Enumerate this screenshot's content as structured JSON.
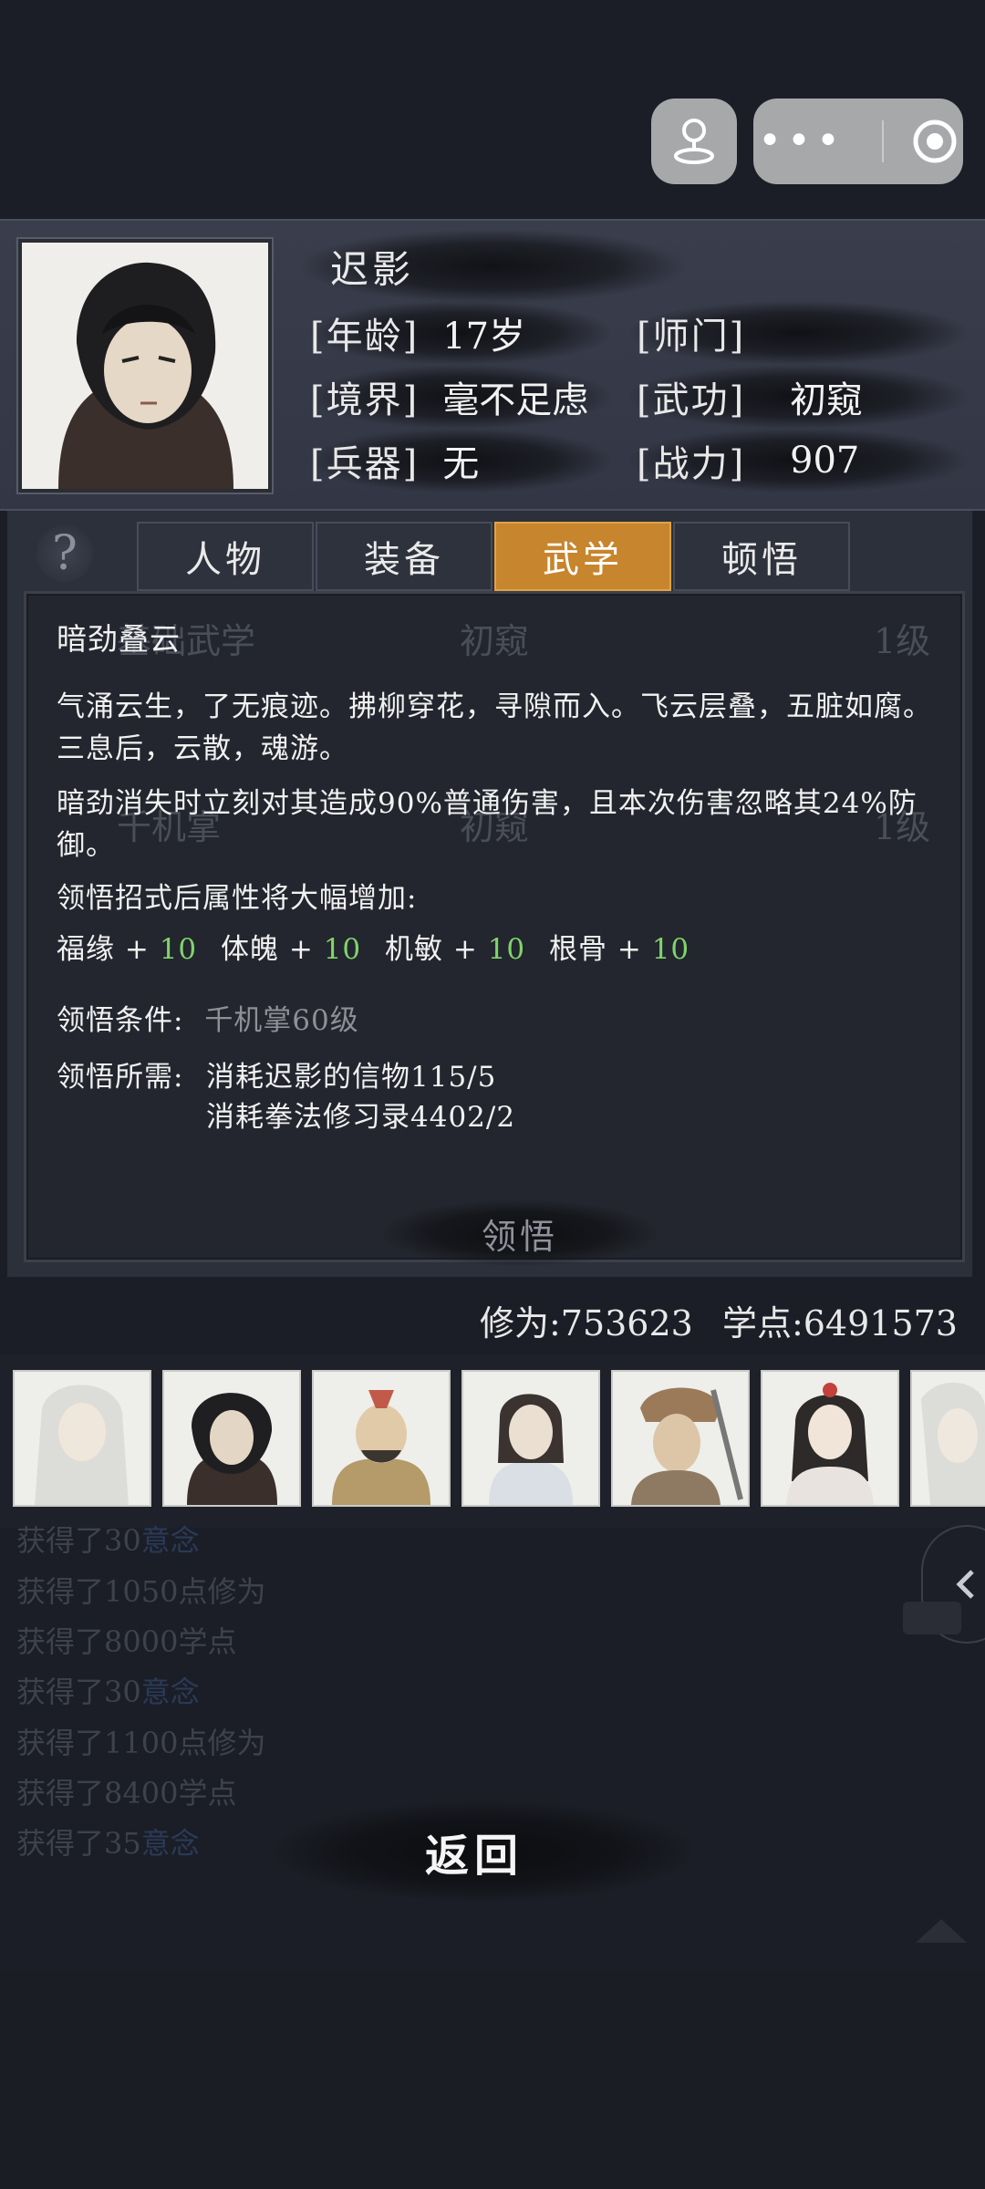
{
  "profile": {
    "name": "迟影",
    "rows": [
      {
        "label": "[年龄]",
        "value": "17岁",
        "label2": "[师门]",
        "value2": ""
      },
      {
        "label": "[境界]",
        "value": "毫不足虑",
        "label2": "[武功]",
        "value2": "初窥"
      },
      {
        "label": "[兵器]",
        "value": "无",
        "label2": "[战力]",
        "value2": "907"
      }
    ]
  },
  "tabs": [
    "人物",
    "装备",
    "武学",
    "顿悟"
  ],
  "active_tab": "武学",
  "help_symbol": "?",
  "background_ghost": {
    "row1": [
      "基础武学",
      "初窥",
      "1级"
    ],
    "row4": [
      "千机掌",
      "初窥",
      "1级"
    ]
  },
  "tooltip": {
    "title": "暗劲叠云",
    "desc1": "气涌云生，了无痕迹。拂柳穿花，寻隙而入。飞云层叠，五脏如腐。三息后，云散，魂游。",
    "desc2": "暗劲消失时立刻对其造成90%普通伤害，且本次伤害忽略其24%防御。",
    "bonus_header": "领悟招式后属性将大幅增加:",
    "bonuses": [
      {
        "name": "福缘",
        "plus": "+",
        "value": "10"
      },
      {
        "name": "体魄",
        "plus": "+",
        "value": "10"
      },
      {
        "name": "机敏",
        "plus": "+",
        "value": "10"
      },
      {
        "name": "根骨",
        "plus": "+",
        "value": "10"
      }
    ],
    "condition_label": "领悟条件:",
    "condition_value": "千机掌60级",
    "cost_label": "领悟所需:",
    "cost1": "消耗迟影的信物115/5",
    "cost2": "消耗拳法修习录4402/2"
  },
  "lingwu_button": "领悟",
  "stats": {
    "xiuwei_label": "修为:",
    "xiuwei": "753623",
    "xuedian_label": "学点:",
    "xuedian": "6491573"
  },
  "log": [
    {
      "text": "获得了30",
      "extra": "意念"
    },
    {
      "text": "获得了1050点修为",
      "extra": ""
    },
    {
      "text": "获得了8000学点",
      "extra": ""
    },
    {
      "text": "获得了30",
      "extra": "意念"
    },
    {
      "text": "获得了1100点修为",
      "extra": ""
    },
    {
      "text": "获得了8400学点",
      "extra": ""
    },
    {
      "text": "获得了35",
      "extra": "意念"
    }
  ],
  "back_button": "返回",
  "colors": {
    "accent": "#c7852e",
    "green": "#7fd46b",
    "panel": "#23262e"
  }
}
